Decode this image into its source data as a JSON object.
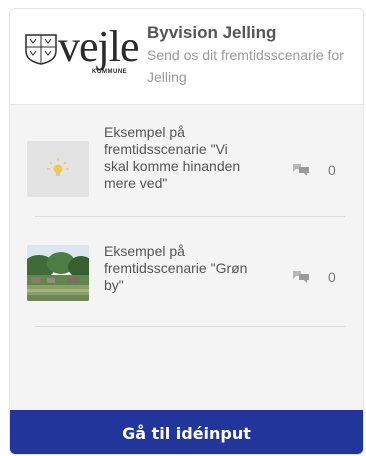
{
  "header": {
    "logo": {
      "wordmark": "vejle",
      "sub": "KOMMUNE"
    },
    "title": "Byvision Jelling",
    "subtitle": "Send os dit fremtidsscenarie for Jelling"
  },
  "items": [
    {
      "text": "Eksempel på fremtidsscenarie \"Vi skal komme hinanden mere ved\"",
      "thumbnail": "lightbulb-icon",
      "comment_count": "0"
    },
    {
      "text": "Eksempel på fremtidsscenarie \"Grøn by\"",
      "thumbnail": "photo-green-town",
      "comment_count": "0"
    }
  ],
  "cta_label": "Gå til idéinput",
  "colors": {
    "cta_background": "#22359a",
    "list_background": "#f4f4f4",
    "title_text": "#555555",
    "subtitle_text": "#9a9a9a"
  }
}
